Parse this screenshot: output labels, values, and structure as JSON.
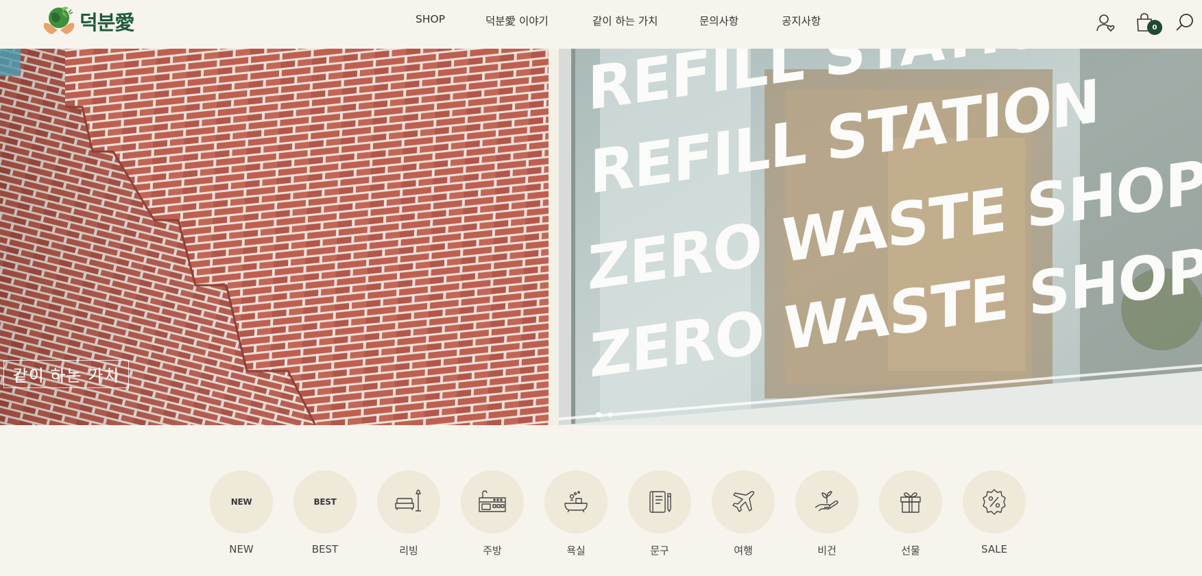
{
  "header": {
    "logo_text": "덕분愛",
    "nav": [
      {
        "label": "SHOP"
      },
      {
        "label": "덕분愛 이야기"
      },
      {
        "label": "같이 하는 가치"
      },
      {
        "label": "문의사항"
      },
      {
        "label": "공지사항"
      }
    ],
    "icons": [
      "user-heart-icon",
      "shopping-bag-icon",
      "search-icon"
    ],
    "cart_count": "0"
  },
  "banner": {
    "left_caption": "같이 하는 가치",
    "sign_lines": [
      "REFILL STATION",
      "REFILL STATION",
      "ZERO WASTE SHOP",
      "ZERO WASTE SHOP"
    ],
    "slides": 2,
    "active_slide": 1
  },
  "categories": [
    {
      "circle_text": "NEW",
      "label": "NEW",
      "icon": null
    },
    {
      "circle_text": "BEST",
      "label": "BEST",
      "icon": null
    },
    {
      "circle_text": "",
      "label": "리빙",
      "icon": "sofa-lamp-icon"
    },
    {
      "circle_text": "",
      "label": "주방",
      "icon": "stove-icon"
    },
    {
      "circle_text": "",
      "label": "욕실",
      "icon": "bathtub-icon"
    },
    {
      "circle_text": "",
      "label": "문구",
      "icon": "notebook-pen-icon"
    },
    {
      "circle_text": "",
      "label": "여행",
      "icon": "airplane-icon"
    },
    {
      "circle_text": "",
      "label": "비건",
      "icon": "sprout-hand-icon"
    },
    {
      "circle_text": "",
      "label": "선물",
      "icon": "gift-icon"
    },
    {
      "circle_text": "",
      "label": "SALE",
      "icon": "discount-badge-icon"
    }
  ],
  "colors": {
    "background": "#f6f4ec",
    "brand_green": "#1f5b3a",
    "badge_green": "#1f4a33",
    "category_circle": "#efe9da",
    "brick": "#b8584a"
  }
}
